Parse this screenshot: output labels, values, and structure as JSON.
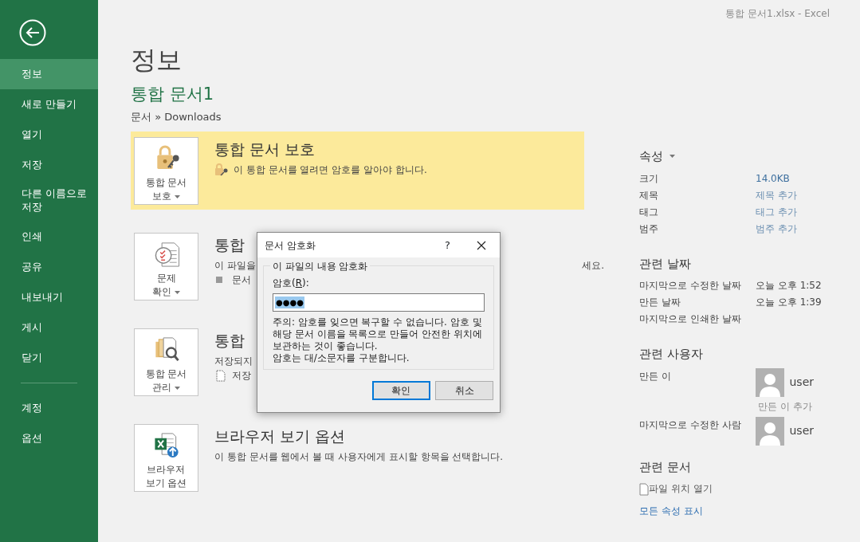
{
  "window": {
    "title": "통합 문서1.xlsx - Excel"
  },
  "sidebar": {
    "items": [
      {
        "label": "정보",
        "selected": true
      },
      {
        "label": "새로 만들기",
        "selected": false
      },
      {
        "label": "열기",
        "selected": false
      },
      {
        "label": "저장",
        "selected": false
      },
      {
        "label": "다른 이름으로 저장",
        "selected": false
      },
      {
        "label": "인쇄",
        "selected": false
      },
      {
        "label": "공유",
        "selected": false
      },
      {
        "label": "내보내기",
        "selected": false
      },
      {
        "label": "게시",
        "selected": false
      },
      {
        "label": "닫기",
        "selected": false
      }
    ],
    "bottom_items": [
      {
        "label": "계정",
        "selected": false
      },
      {
        "label": "옵션",
        "selected": false
      }
    ]
  },
  "page": {
    "heading": "정보",
    "document_name": "통합 문서1",
    "path": "문서 » Downloads"
  },
  "sections": [
    {
      "kind": "protect",
      "button_lines": [
        "통합 문서",
        "보호"
      ],
      "dropdown": true,
      "title": "통합 문서 보호",
      "highlighted": true,
      "lines": [
        {
          "kind": "lock",
          "parts": [
            "이 통합 문서를 열려면 암호를 알아야 합니다."
          ]
        }
      ]
    },
    {
      "kind": "inspect",
      "button_lines": [
        "문제",
        "확인"
      ],
      "dropdown": true,
      "title": "통합",
      "highlighted": false,
      "lines": [
        {
          "kind": "text",
          "parts": [
            "이 파일을",
            "세요."
          ]
        },
        {
          "kind": "bullet",
          "parts": [
            "문서"
          ]
        }
      ]
    },
    {
      "kind": "manage",
      "button_lines": [
        "통합 문서",
        "관리"
      ],
      "dropdown": true,
      "title": "통합",
      "highlighted": false,
      "lines": [
        {
          "kind": "text",
          "parts": [
            "저장되지"
          ]
        },
        {
          "kind": "file",
          "parts": [
            "저장"
          ]
        }
      ]
    },
    {
      "kind": "browser",
      "button_lines": [
        "브라우저",
        "보기 옵션"
      ],
      "dropdown": false,
      "title": "브라우저 보기 옵션",
      "highlighted": false,
      "lines": [
        {
          "kind": "text",
          "parts": [
            "이 통합 문서를 웹에서 볼 때 사용자에게 표시할 항목을 선택합니다."
          ]
        }
      ]
    }
  ],
  "properties": {
    "heading": "속성",
    "rows": [
      {
        "label": "크기",
        "value": "14.0KB",
        "kind": "plain"
      },
      {
        "label": "제목",
        "value": "제목 추가",
        "kind": "placeholder"
      },
      {
        "label": "태그",
        "value": "태그 추가",
        "kind": "placeholder"
      },
      {
        "label": "범주",
        "value": "범주 추가",
        "kind": "placeholder"
      }
    ]
  },
  "related_dates": {
    "heading": "관련 날짜",
    "rows": [
      {
        "label": "마지막으로 수정한 날짜",
        "value": "오늘 오후 1:52"
      },
      {
        "label": "만든 날짜",
        "value": "오늘 오후 1:39"
      },
      {
        "label": "마지막으로 인쇄한 날짜"
      }
    ]
  },
  "related_people": {
    "heading": "관련 사용자",
    "rows": [
      {
        "label": "만든 이",
        "user": "user",
        "add_link": "만든 이 추가"
      },
      {
        "label": "마지막으로 수정한 사람",
        "user": "user"
      }
    ]
  },
  "related_documents": {
    "heading": "관련 문서",
    "items": [
      "파일 위치 열기"
    ],
    "link": "모든 속성 표시"
  },
  "dialog": {
    "title": "문서 암호화",
    "help": "?",
    "group_label": "이 파일의 내용 암호화",
    "field_label": [
      "암호(",
      "R",
      "):"
    ],
    "password": "●●●●",
    "password_selected": true,
    "notes": [
      "주의: 암호를 잊으면 복구할 수 없습니다. 암호 및 해당 문서 이름을 목록으로 만들어 안전한 위치에 보관하는 것이 좋습니다.",
      "암호는 대/소문자를 구분합니다."
    ],
    "buttons": [
      {
        "label": "확인",
        "default": true
      },
      {
        "label": "취소",
        "default": false
      }
    ]
  }
}
